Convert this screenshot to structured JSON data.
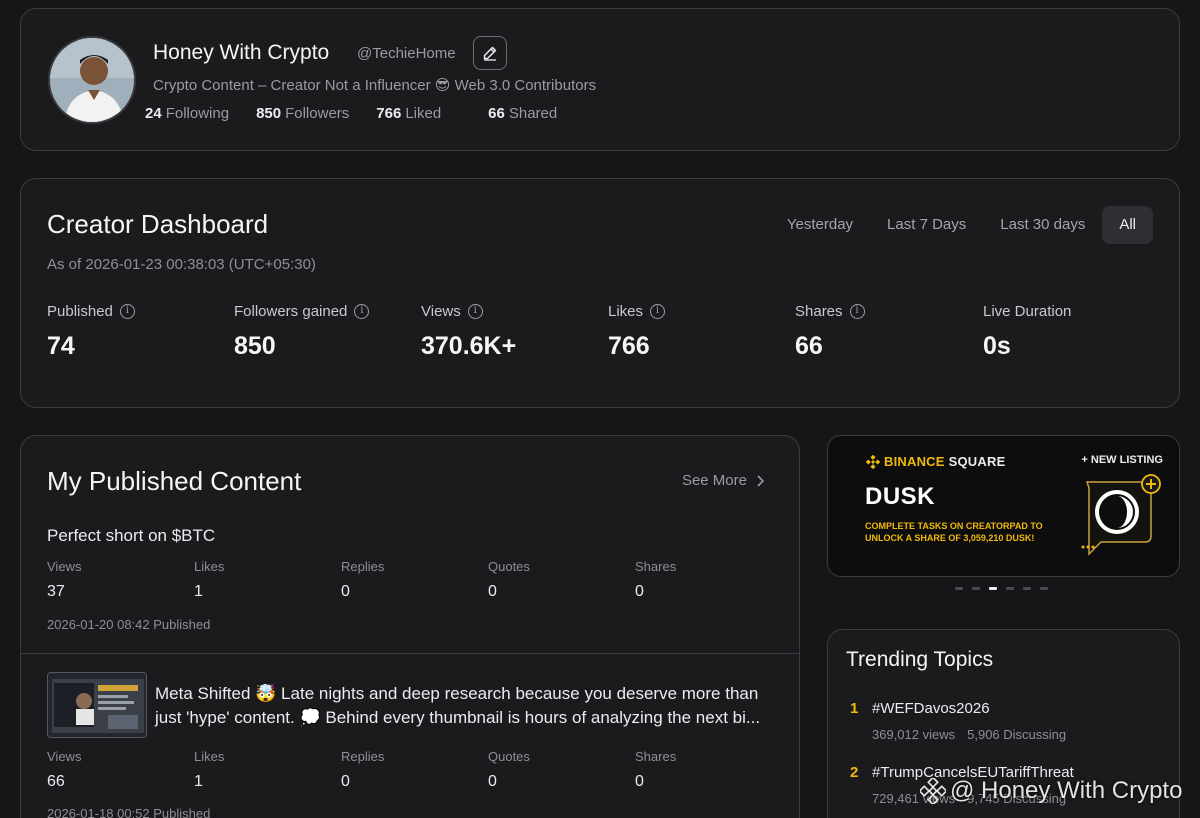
{
  "profile": {
    "name": "Honey With Crypto",
    "handle": "@TechieHome",
    "bio": "Crypto Content – Creator Not a Influencer 😎 Web 3.0 Contributors",
    "stats": [
      {
        "value": "24",
        "label": "Following"
      },
      {
        "value": "850",
        "label": "Followers"
      },
      {
        "value": "766",
        "label": "Liked"
      },
      {
        "value": "66",
        "label": "Shared"
      }
    ]
  },
  "dashboard": {
    "title": "Creator Dashboard",
    "as_of": "As of 2026-01-23 00:38:03 (UTC+05:30)",
    "ranges": [
      "Yesterday",
      "Last 7 Days",
      "Last 30 days",
      "All"
    ],
    "active_range": "All",
    "metrics": [
      {
        "label": "Published",
        "value": "74",
        "info": true
      },
      {
        "label": "Followers gained",
        "value": "850",
        "info": true
      },
      {
        "label": "Views",
        "value": "370.6K+",
        "info": true
      },
      {
        "label": "Likes",
        "value": "766",
        "info": true
      },
      {
        "label": "Shares",
        "value": "66",
        "info": true
      },
      {
        "label": "Live Duration",
        "value": "0s",
        "info": false
      }
    ]
  },
  "published": {
    "title": "My Published Content",
    "see_more": "See More",
    "stat_labels": [
      "Views",
      "Likes",
      "Replies",
      "Quotes",
      "Shares"
    ],
    "posts": [
      {
        "text": "Perfect short on $BTC",
        "values": [
          "37",
          "1",
          "0",
          "0",
          "0"
        ],
        "date": "2026-01-20 08:42 Published"
      },
      {
        "text": "Meta Shifted 🤯 Late nights and deep research because you deserve more than just 'hype' content. 💭 Behind every thumbnail is hours of analyzing the next bi...",
        "values": [
          "66",
          "1",
          "0",
          "0",
          "0"
        ],
        "date": "2026-01-18 00:52 Published"
      }
    ]
  },
  "banner": {
    "brand": "BINANCE",
    "brand_suffix": "SQUARE",
    "badge": "+ NEW LISTING",
    "coin": "DUSK",
    "description": "COMPLETE TASKS ON CREATORPAD TO UNLOCK A SHARE OF 3,059,210 DUSK!",
    "slides": 6,
    "active_slide": 3
  },
  "trending": {
    "title": "Trending Topics",
    "topics": [
      {
        "rank": "1",
        "name": "#WEFDavos2026",
        "views": "369,012 views",
        "discussing": "5,906 Discussing"
      },
      {
        "rank": "2",
        "name": "#TrumpCancelsEUTariffThreat",
        "views": "729,461 views",
        "discussing": "9,745 Discussing"
      }
    ]
  },
  "watermark": {
    "text": "@ Honey With Crypto"
  },
  "colors": {
    "background": "#161618",
    "card": "#1b1b1e",
    "border": "#3b3c40",
    "accent": "#f0b90b"
  }
}
